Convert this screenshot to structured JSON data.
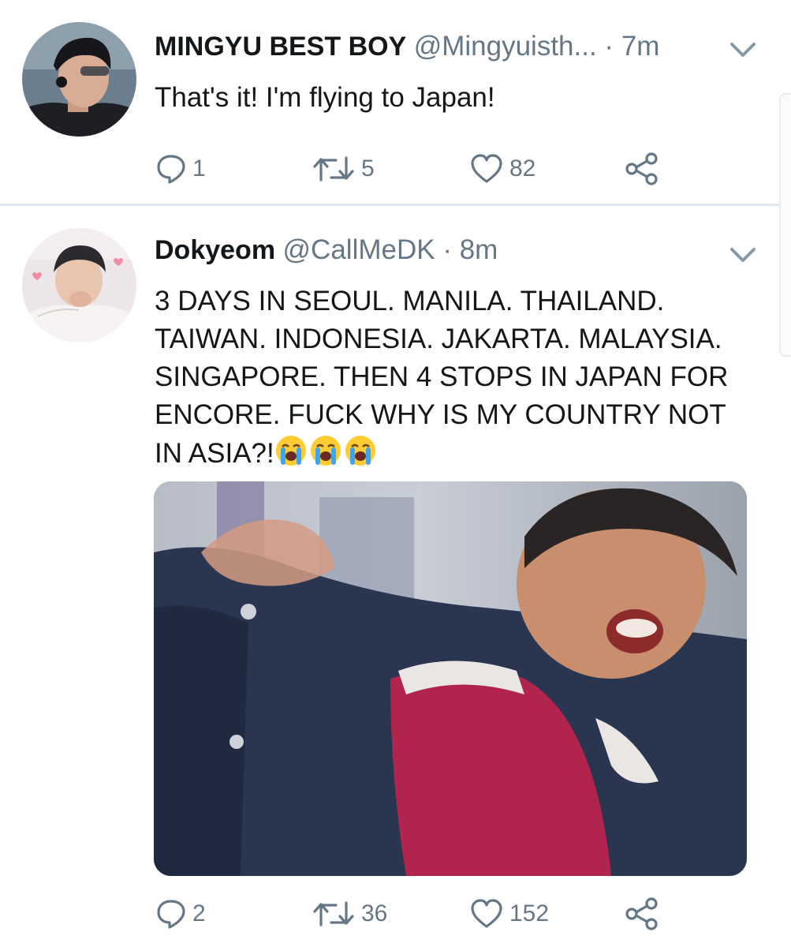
{
  "tweets": [
    {
      "display_name": "MINGYU BEST BOY",
      "handle": "@Mingyuisth...",
      "separator": " · ",
      "time": "7m",
      "text": "That's it! I'm flying to Japan!",
      "emojis": [],
      "has_media": false,
      "replies": "1",
      "retweets": "5",
      "likes": "82"
    },
    {
      "display_name": "Dokyeom",
      "handle": "@CallMeDK",
      "separator": " · ",
      "time": "8m",
      "text": "3 DAYS IN SEOUL. MANILA. THAILAND.\nTAIWAN. INDONESIA. JAKARTA. MALAYSIA.\nSINGAPORE. THEN 4 STOPS IN JAPAN FOR\nENCORE. FUCK WHY IS MY COUNTRY NOT\nIN ASIA?!",
      "emojis": [
        "loudly-crying-face-icon",
        "loudly-crying-face-icon",
        "loudly-crying-face-icon"
      ],
      "has_media": true,
      "replies": "2",
      "retweets": "36",
      "likes": "152"
    }
  ],
  "icons": {
    "reply": "reply-icon",
    "retweet": "retweet-icon",
    "like": "heart-icon",
    "share": "share-icon",
    "menu": "chevron-down-icon"
  },
  "colors": {
    "text": "#14171a",
    "muted": "#657786",
    "divider": "#e1e8ed"
  }
}
